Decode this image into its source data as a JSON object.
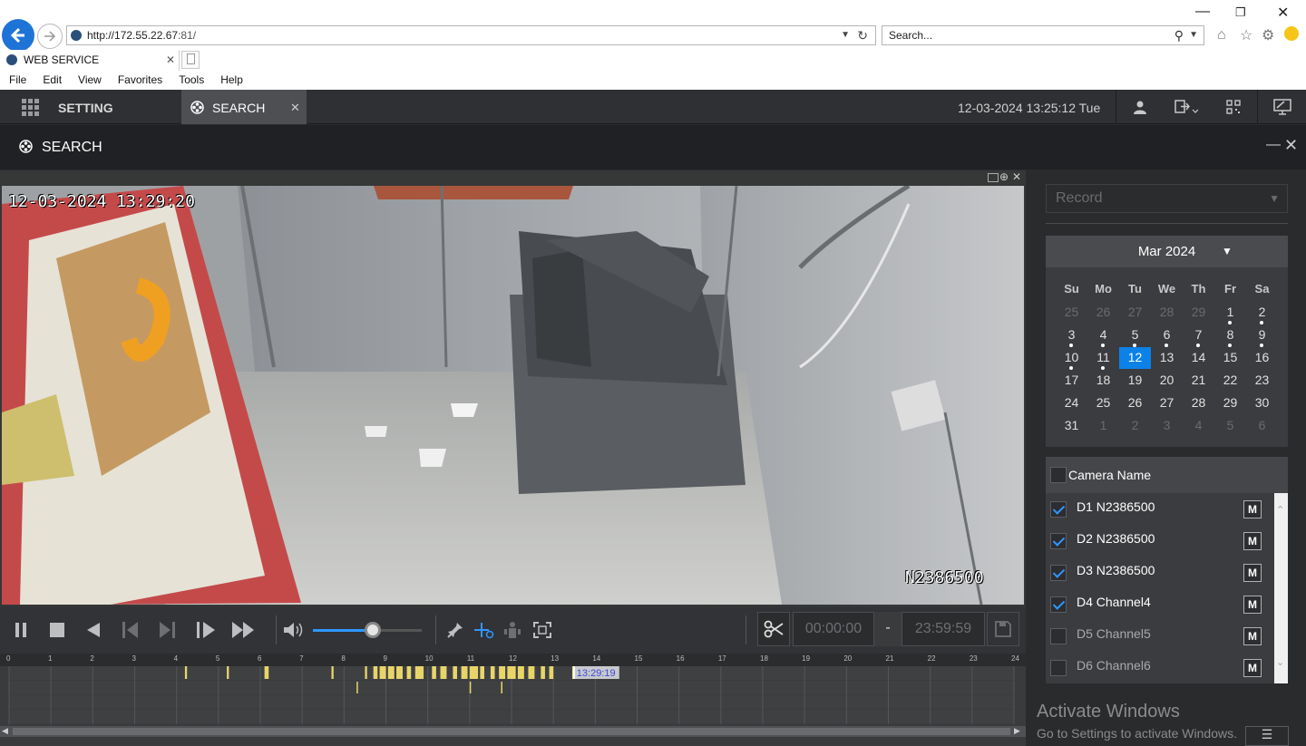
{
  "browser": {
    "url_host": "http://172.55.22.67",
    "url_port": ":81/",
    "search_placeholder": "Search...",
    "tab_title": "WEB SERVICE",
    "menu": [
      "File",
      "Edit",
      "View",
      "Favorites",
      "Tools",
      "Help"
    ]
  },
  "app": {
    "tabs": [
      {
        "label": "SETTING"
      },
      {
        "label": "SEARCH"
      }
    ],
    "datetime": "12-03-2024 13:25:12 Tue",
    "page_title": "SEARCH"
  },
  "video": {
    "timestamp": "12-03-2024 13:29:20",
    "camera_label": "N2386500"
  },
  "controls": {
    "volume_level": 0.55,
    "clip_start": "00:00:00",
    "clip_sep": "-",
    "clip_end": "23:59:59"
  },
  "timeline": {
    "hours": [
      "0",
      "1",
      "2",
      "3",
      "4",
      "5",
      "6",
      "7",
      "8",
      "9",
      "10",
      "11",
      "12",
      "13",
      "14",
      "15",
      "16",
      "17",
      "18",
      "19",
      "20",
      "21",
      "22",
      "23",
      "24"
    ],
    "cursor_time": "13:29:19",
    "cursor_hour": 13.49,
    "record_segments": [
      [
        4.2,
        4.25
      ],
      [
        5.2,
        5.25
      ],
      [
        6.1,
        6.2
      ],
      [
        7.7,
        7.75
      ],
      [
        8.5,
        8.55
      ],
      [
        8.7,
        8.8
      ],
      [
        8.85,
        9.0
      ],
      [
        9.05,
        9.2
      ],
      [
        9.25,
        9.4
      ],
      [
        9.5,
        9.6
      ],
      [
        9.7,
        9.9
      ],
      [
        10.1,
        10.2
      ],
      [
        10.3,
        10.45
      ],
      [
        10.6,
        10.7
      ],
      [
        10.8,
        10.95
      ],
      [
        11.0,
        11.2
      ],
      [
        11.25,
        11.35
      ],
      [
        11.5,
        11.6
      ],
      [
        11.7,
        11.85
      ],
      [
        11.9,
        12.1
      ],
      [
        12.15,
        12.3
      ],
      [
        12.4,
        12.55
      ],
      [
        12.7,
        12.8
      ],
      [
        12.9,
        13.0
      ],
      [
        13.45,
        13.5
      ]
    ],
    "event_marks": [
      8.3,
      11.0,
      11.75
    ]
  },
  "right_panel": {
    "record_type": "Record",
    "calendar": {
      "month_label": "Mar 2024",
      "weekdays": [
        "Su",
        "Mo",
        "Tu",
        "We",
        "Th",
        "Fr",
        "Sa"
      ],
      "days": [
        {
          "d": "25",
          "m": true
        },
        {
          "d": "26",
          "m": true
        },
        {
          "d": "27",
          "m": true
        },
        {
          "d": "28",
          "m": true
        },
        {
          "d": "29",
          "m": true
        },
        {
          "d": "1",
          "dot": true
        },
        {
          "d": "2",
          "dot": true
        },
        {
          "d": "3",
          "dot": true
        },
        {
          "d": "4",
          "dot": true
        },
        {
          "d": "5",
          "dot": true
        },
        {
          "d": "6",
          "dot": true
        },
        {
          "d": "7",
          "dot": true
        },
        {
          "d": "8",
          "dot": true
        },
        {
          "d": "9",
          "dot": true
        },
        {
          "d": "10",
          "dot": true
        },
        {
          "d": "11",
          "dot": true
        },
        {
          "d": "12",
          "sel": true
        },
        {
          "d": "13"
        },
        {
          "d": "14"
        },
        {
          "d": "15"
        },
        {
          "d": "16"
        },
        {
          "d": "17"
        },
        {
          "d": "18"
        },
        {
          "d": "19"
        },
        {
          "d": "20"
        },
        {
          "d": "21"
        },
        {
          "d": "22"
        },
        {
          "d": "23"
        },
        {
          "d": "24"
        },
        {
          "d": "25"
        },
        {
          "d": "26"
        },
        {
          "d": "27"
        },
        {
          "d": "28"
        },
        {
          "d": "29"
        },
        {
          "d": "30"
        },
        {
          "d": "31"
        },
        {
          "d": "1",
          "m": true
        },
        {
          "d": "2",
          "m": true
        },
        {
          "d": "3",
          "m": true
        },
        {
          "d": "4",
          "m": true
        },
        {
          "d": "5",
          "m": true
        },
        {
          "d": "6",
          "m": true
        }
      ]
    },
    "camera_header": "Camera Name",
    "cameras": [
      {
        "label": "D1 N2386500",
        "checked": true,
        "m": "M"
      },
      {
        "label": "D2 N2386500",
        "checked": true,
        "m": "M"
      },
      {
        "label": "D3 N2386500",
        "checked": true,
        "m": "M"
      },
      {
        "label": "D4 Channel4",
        "checked": true,
        "m": "M"
      },
      {
        "label": "D5 Channel5",
        "checked": false,
        "m": "M"
      },
      {
        "label": "D6 Channel6",
        "checked": false,
        "m": "M"
      }
    ],
    "watermark_title": "Activate Windows",
    "watermark_sub": "Go to Settings to activate Windows."
  },
  "colors": {
    "accent": "#0c82e8",
    "record_bar": "#e8d56a",
    "cursor_label": "#3b49d8"
  }
}
